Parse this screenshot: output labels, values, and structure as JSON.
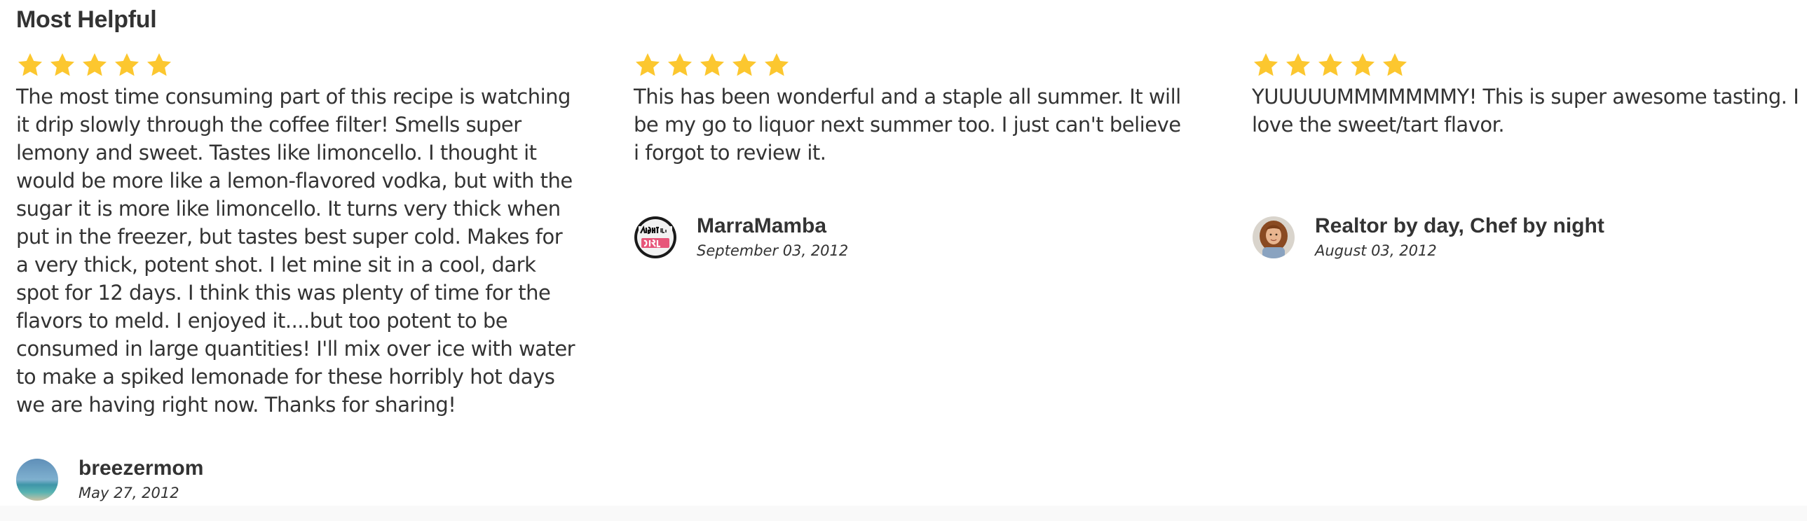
{
  "section": {
    "title": "Most Helpful"
  },
  "colors": {
    "star": "#fcc72f",
    "text": "#333333"
  },
  "reviews": [
    {
      "rating": 5,
      "text": "The most time consuming part of this recipe is watching it drip slowly through the coffee filter! Smells super lemony and sweet. Tastes like limoncello. I thought it would be more like a lemon-flavored vodka, but with the sugar it is more like limoncello. It turns very thick when put in the freezer, but tastes best super cold. Makes for a very thick, potent shot. I let mine sit in a cool, dark spot for 12 days. I think this was plenty of time for the flavors to meld. I enjoyed it....but too potent to be consumed in large quantities! I'll mix over ice with water to make a spiked lemonade for these horribly hot days we are having right now. Thanks for sharing!",
      "author": "breezermom",
      "date": "May 27, 2012",
      "avatar_icon": "beach-avatar"
    },
    {
      "rating": 5,
      "text": "This has been wonderful and a staple all summer. It will be my go to liquor next summer too. I just can't believe i forgot to review it.",
      "author": "MarraMamba",
      "date": "September 03, 2012",
      "avatar_icon": "fight-like-girl-avatar"
    },
    {
      "rating": 5,
      "text": "YUUUUUMMMMMMMY! This is super awesome tasting. I love the sweet/tart flavor.",
      "author": "Realtor by day, Chef by night",
      "date": "August 03, 2012",
      "avatar_icon": "portrait-avatar"
    }
  ]
}
